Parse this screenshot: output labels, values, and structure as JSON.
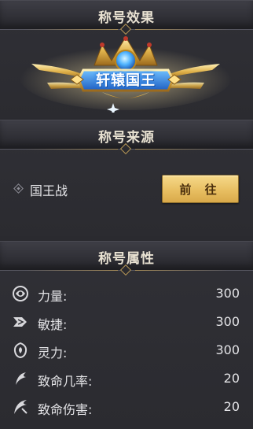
{
  "effect_section": {
    "title": "称号效果",
    "badge": {
      "text": "轩辕国王",
      "icon": "royal-crown-badge"
    }
  },
  "source_section": {
    "title": "称号来源",
    "source_label": "国王战",
    "go_button_label": "前 往"
  },
  "attributes_section": {
    "title": "称号属性",
    "items": [
      {
        "name": "力量:",
        "value": "300",
        "icon": "strength-icon"
      },
      {
        "name": "敏捷:",
        "value": "300",
        "icon": "agility-icon"
      },
      {
        "name": "灵力:",
        "value": "300",
        "icon": "spirit-icon"
      },
      {
        "name": "致命几率:",
        "value": "20",
        "icon": "crit-chance-icon"
      },
      {
        "name": "致命伤害:",
        "value": "20",
        "icon": "crit-damage-icon"
      }
    ]
  },
  "colors": {
    "panel_bg": "#2a2a2f",
    "title_text": "#e9e2d2",
    "button_gold": "#e8bf62",
    "badge_blue": "#2f7fe0"
  }
}
